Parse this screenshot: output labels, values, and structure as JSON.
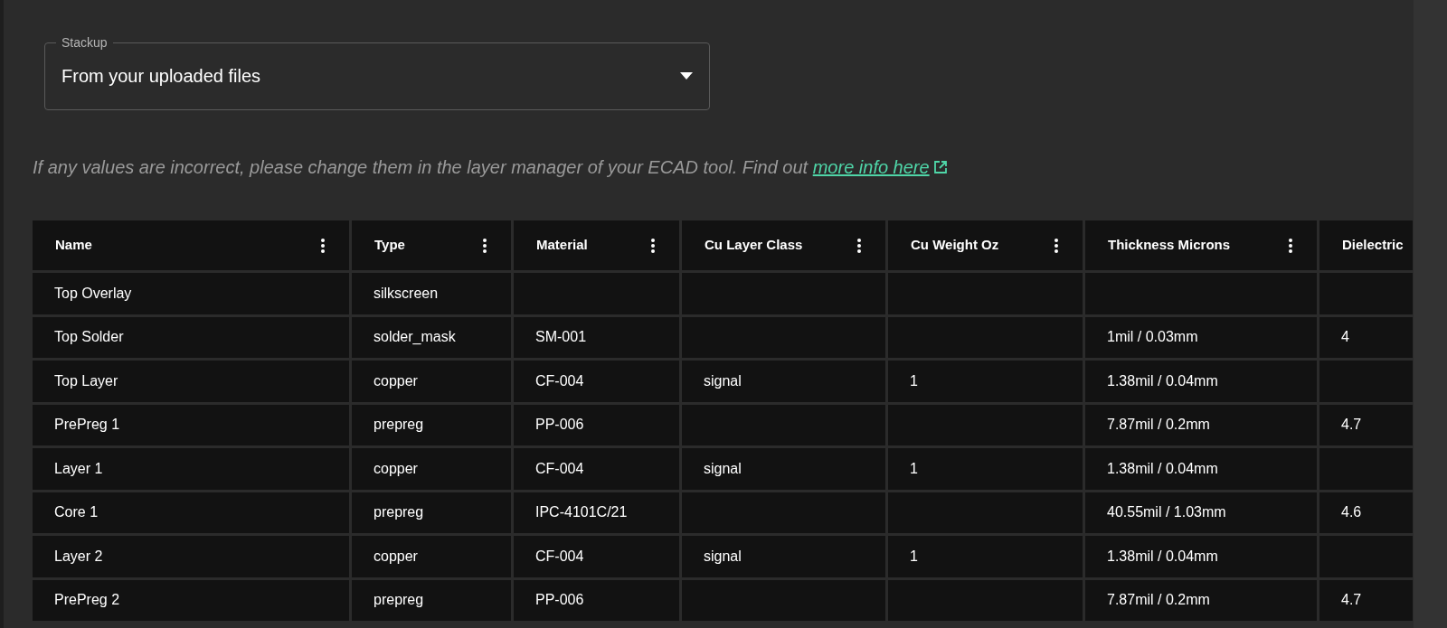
{
  "stackup": {
    "label": "Stackup",
    "value": "From your uploaded files"
  },
  "info": {
    "text": "If any values are incorrect, please change them in the layer manager of your ECAD tool. Find out",
    "link": "more info here"
  },
  "table": {
    "columns": [
      {
        "label": "Name",
        "menu": true
      },
      {
        "label": "Type",
        "menu": true
      },
      {
        "label": "Material",
        "menu": true
      },
      {
        "label": "Cu Layer Class",
        "menu": true
      },
      {
        "label": "Cu Weight Oz",
        "menu": true
      },
      {
        "label": "Thickness Microns",
        "menu": true
      },
      {
        "label": "Dielectric",
        "menu": false
      }
    ],
    "rows": [
      [
        "Top Overlay",
        "silkscreen",
        "",
        "",
        "",
        "",
        ""
      ],
      [
        "Top Solder",
        "solder_mask",
        "SM-001",
        "",
        "",
        "1mil / 0.03mm",
        "4"
      ],
      [
        "Top Layer",
        "copper",
        "CF-004",
        "signal",
        "1",
        "1.38mil / 0.04mm",
        ""
      ],
      [
        "PrePreg 1",
        "prepreg",
        "PP-006",
        "",
        "",
        "7.87mil / 0.2mm",
        "4.7"
      ],
      [
        "Layer 1",
        "copper",
        "CF-004",
        "signal",
        "1",
        "1.38mil / 0.04mm",
        ""
      ],
      [
        "Core 1",
        "prepreg",
        "IPC-4101C/21",
        "",
        "",
        "40.55mil / 1.03mm",
        "4.6"
      ],
      [
        "Layer 2",
        "copper",
        "CF-004",
        "signal",
        "1",
        "1.38mil / 0.04mm",
        ""
      ],
      [
        "PrePreg 2",
        "prepreg",
        "PP-006",
        "",
        "",
        "7.87mil / 0.2mm",
        "4.7"
      ]
    ]
  }
}
